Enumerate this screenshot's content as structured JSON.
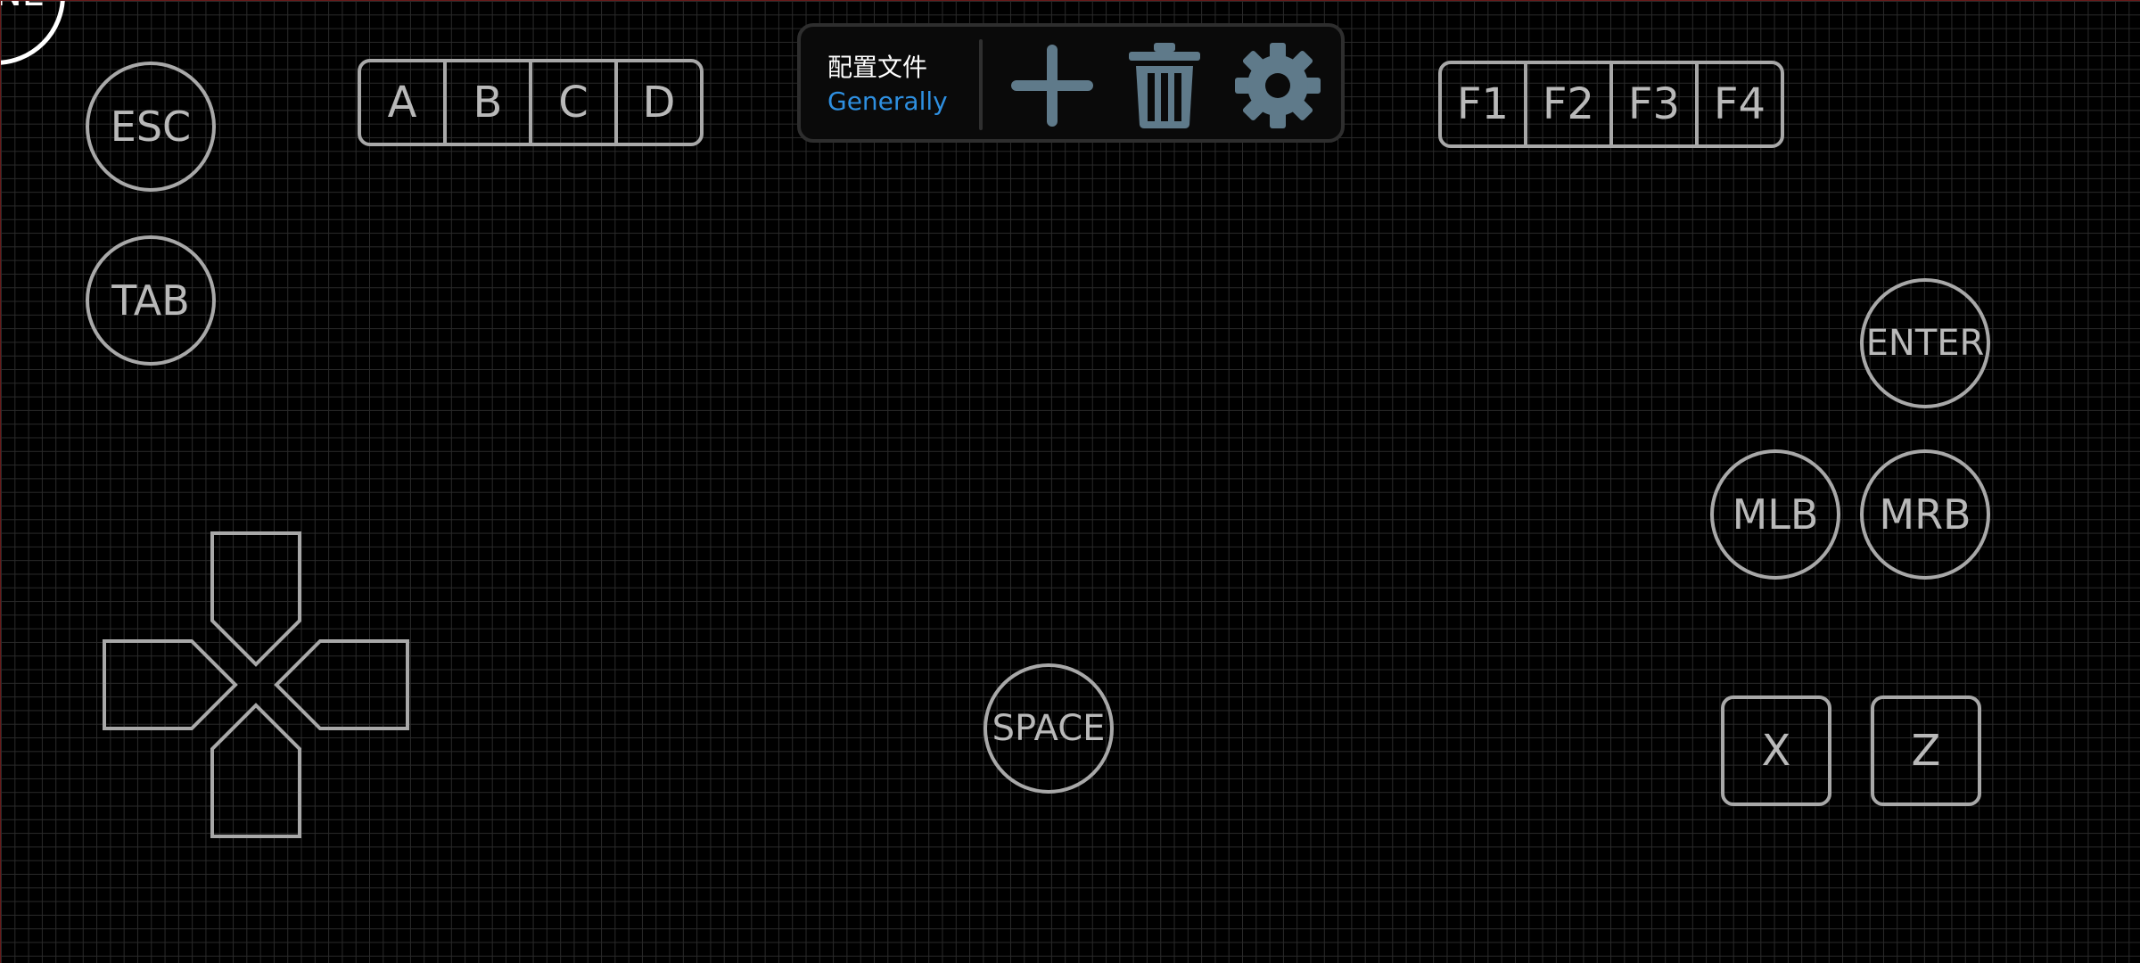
{
  "corner_button": {
    "label": "NE"
  },
  "left_column": {
    "esc_label": "ESC",
    "tab_label": "TAB"
  },
  "letter_group": [
    "A",
    "B",
    "C",
    "D"
  ],
  "function_group": [
    "F1",
    "F2",
    "F3",
    "F4"
  ],
  "toolbar": {
    "profile_title": "配置文件",
    "profile_name": "Generally",
    "add_icon": "plus-icon",
    "delete_icon": "trash-icon",
    "settings_icon": "gear-icon",
    "icon_color": "#5f7a8a",
    "accent_color": "#2e8fe0"
  },
  "center": {
    "space_label": "SPACE"
  },
  "right_column": {
    "enter_label": "ENTER",
    "mlb_label": "MLB",
    "mrb_label": "MRB",
    "x_label": "X",
    "z_label": "Z"
  },
  "dpad": {
    "icon": "dpad-icon"
  },
  "colors": {
    "background": "#000000",
    "grid": "#2a2a2a",
    "key_outline": "#a8a8a8",
    "key_text": "#b9b9b9"
  }
}
